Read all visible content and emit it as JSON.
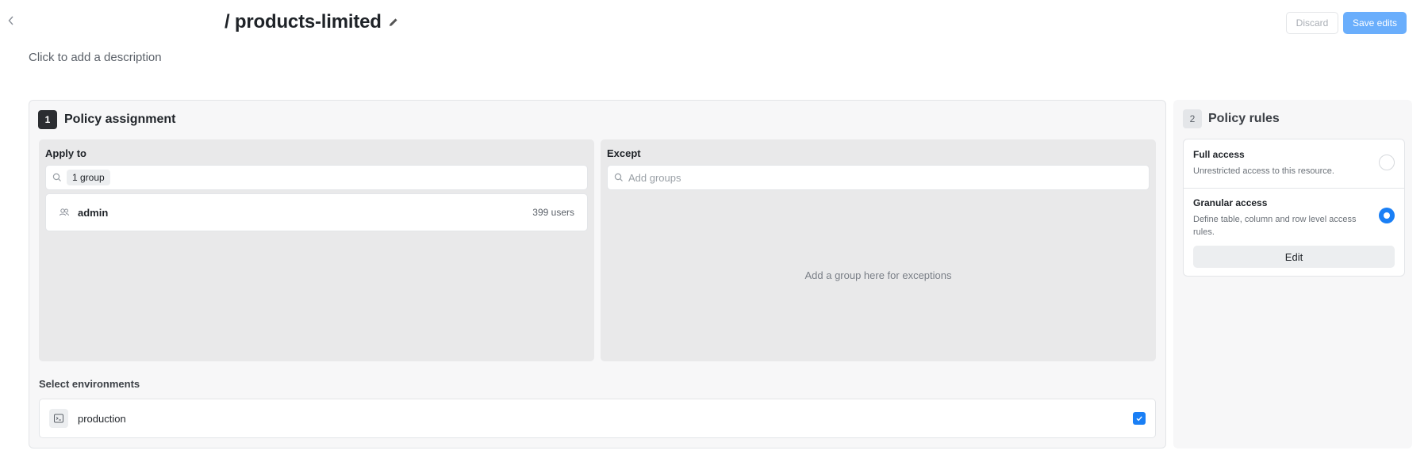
{
  "header": {
    "title": "/ products-limited",
    "description": "Click to add a description",
    "back_icon": "chevron-left-icon",
    "edit_icon": "pencil-icon",
    "discard_label": "Discard",
    "save_label": "Save edits"
  },
  "assignment": {
    "step": "1",
    "title": "Policy assignment",
    "apply_to": {
      "label": "Apply to",
      "chip": "1 group",
      "groups": [
        {
          "name": "admin",
          "count": "399 users"
        }
      ]
    },
    "except": {
      "label": "Except",
      "placeholder": "Add groups",
      "empty_message": "Add a group here for exceptions"
    },
    "environments": {
      "label": "Select environments",
      "items": [
        {
          "name": "production",
          "checked": true
        }
      ]
    }
  },
  "rules": {
    "step": "2",
    "title": "Policy rules",
    "options": [
      {
        "title": "Full access",
        "description": "Unrestricted access to this resource.",
        "selected": false
      },
      {
        "title": "Granular access",
        "description": "Define table, column and row level access rules.",
        "selected": true
      }
    ],
    "edit_label": "Edit"
  },
  "colors": {
    "primary": "#1a7ff5",
    "save_button": "#6aaefc"
  }
}
